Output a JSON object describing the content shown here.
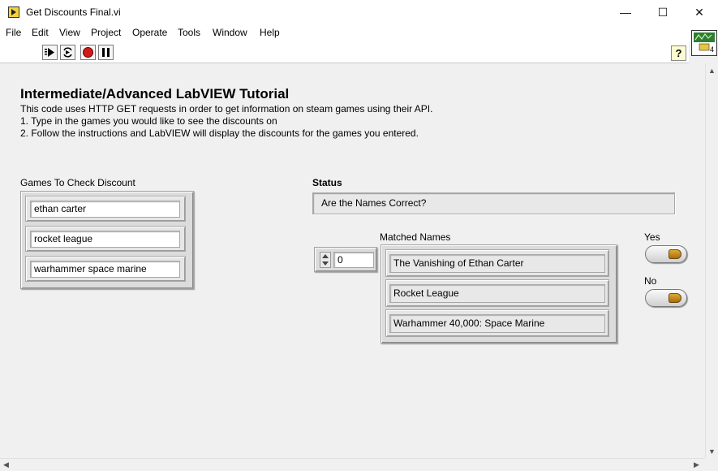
{
  "window": {
    "title": "Get Discounts Final.vi",
    "minimize_glyph": "—",
    "maximize_glyph": "☐",
    "close_glyph": "✕"
  },
  "menu": [
    "File",
    "Edit",
    "View",
    "Project",
    "Operate",
    "Tools",
    "Window",
    "Help"
  ],
  "toolbar": {
    "help_label": "?",
    "vi_icon_count": "4"
  },
  "heading": "Intermediate/Advanced LabVIEW Tutorial",
  "description": [
    "This code uses HTTP GET requests in order to get information on steam games using their API.",
    "1. Type in the games you would like to see the discounts on",
    "2. Follow the instructions and LabVIEW will display the discounts for the games you entered."
  ],
  "games": {
    "label": "Games To Check Discount",
    "items": [
      "ethan carter",
      "rocket league",
      "warhammer space marine"
    ]
  },
  "status": {
    "label": "Status",
    "value": "Are the Names Correct?"
  },
  "index": {
    "value": "0"
  },
  "matched": {
    "label": "Matched Names",
    "items": [
      "The Vanishing of Ethan Carter",
      "Rocket League",
      "Warhammer 40,000: Space Marine"
    ]
  },
  "yes": {
    "label": "Yes"
  },
  "no": {
    "label": "No"
  },
  "colors": {
    "led": "#c8901e",
    "panel": "#f0f0f0"
  }
}
